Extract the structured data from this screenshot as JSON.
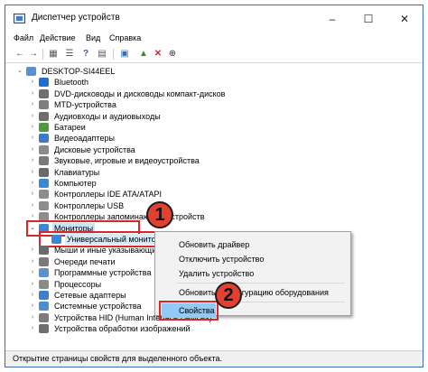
{
  "window": {
    "title": "Диспетчер устройств",
    "controls": {
      "minimize": "–",
      "maximize": "☐",
      "close": "✕"
    }
  },
  "menu": [
    "Файл",
    "Действие",
    "Вид",
    "Справка"
  ],
  "toolbar": [
    {
      "name": "back-icon",
      "glyph": "←"
    },
    {
      "name": "forward-icon",
      "glyph": "→"
    },
    {
      "name": "properties-icon",
      "glyph": "▦"
    },
    {
      "name": "list-view-icon",
      "glyph": "☰"
    },
    {
      "name": "help-icon",
      "glyph": "?"
    },
    {
      "name": "details-icon",
      "glyph": "▤"
    },
    {
      "name": "scan-hardware-icon",
      "glyph": "▣"
    },
    {
      "name": "add-driver-icon",
      "glyph": "▲"
    },
    {
      "name": "remove-device-icon",
      "glyph": "✕"
    },
    {
      "name": "update-driver-icon",
      "glyph": "⊕"
    }
  ],
  "tree": {
    "root": "DESKTOP-SI44EEL",
    "items": [
      {
        "label": "Bluetooth",
        "color": "#1f6fd1"
      },
      {
        "label": "DVD-дисководы и дисководы компакт-дисков",
        "color": "#707070"
      },
      {
        "label": "MTD-устройства",
        "color": "#7f7f7f"
      },
      {
        "label": "Аудиовходы и аудиовыходы",
        "color": "#6d6d6d"
      },
      {
        "label": "Батареи",
        "color": "#4f9a3a"
      },
      {
        "label": "Видеоадаптеры",
        "color": "#3a7bc8"
      },
      {
        "label": "Дисковые устройства",
        "color": "#8a8a8a"
      },
      {
        "label": "Звуковые, игровые и видеоустройства",
        "color": "#7a7a7a"
      },
      {
        "label": "Клавиатуры",
        "color": "#6a6a6a"
      },
      {
        "label": "Компьютер",
        "color": "#3c86d8"
      },
      {
        "label": "Контроллеры IDE ATA/ATAPI",
        "color": "#8d8d8d"
      },
      {
        "label": "Контроллеры USB",
        "color": "#8d8d8d"
      },
      {
        "label": "Контроллеры запоминающих устройств",
        "color": "#8d8d8d"
      }
    ],
    "monitors": {
      "label": "Мониторы",
      "child": "Универсальный монитор"
    },
    "after": [
      {
        "label": "Мыши и иные указывающие устройства",
        "color": "#6a6a6a"
      },
      {
        "label": "Очереди печати",
        "color": "#7a7a7a"
      },
      {
        "label": "Программные устройства",
        "color": "#5b8fd0"
      },
      {
        "label": "Процессоры",
        "color": "#8a8a8a"
      },
      {
        "label": "Сетевые адаптеры",
        "color": "#3f7fcf"
      },
      {
        "label": "Системные устройства",
        "color": "#4a8fd6"
      },
      {
        "label": "Устройства HID (Human Interface Devices)",
        "color": "#7c7c7c"
      },
      {
        "label": "Устройства обработки изображений",
        "color": "#6f6f6f"
      }
    ]
  },
  "context_menu": {
    "update": "Обновить драйвер",
    "disable": "Отключить устройство",
    "remove": "Удалить устройство",
    "scan": "Обновить конфигурацию оборудования",
    "properties": "Свойства"
  },
  "badges": [
    "1",
    "2"
  ],
  "status": "Открытие страницы свойств для выделенного объекта."
}
